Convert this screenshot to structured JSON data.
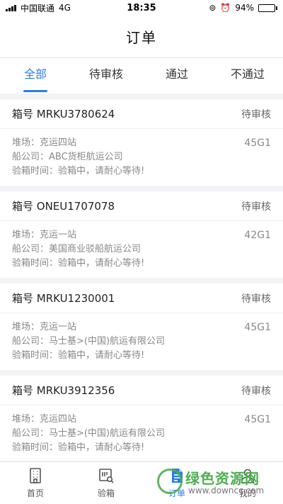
{
  "status_bar": {
    "carrier": "中国联通",
    "network": "4G",
    "time": "18:35",
    "battery": "94%",
    "battery_level": 0.94
  },
  "header": {
    "title": "订单"
  },
  "tabs": [
    {
      "label": "全部",
      "active": true
    },
    {
      "label": "待审核",
      "active": false
    },
    {
      "label": "通过",
      "active": false
    },
    {
      "label": "不通过",
      "active": false
    }
  ],
  "orders": [
    {
      "box_no": "箱号 MRKU3780624",
      "status": "待审核",
      "yard": "堆场：克运四站",
      "company": "船公司：ABC货柜航运公司",
      "inspection": "验箱时间：验箱中，请耐心等待!",
      "size": "45G1"
    },
    {
      "box_no": "箱号 ONEU1707078",
      "status": "待审核",
      "yard": "堆场：克运一站",
      "company": "船公司：美国商业驳船航运公司",
      "inspection": "验箱时间：验箱中，请耐心等待!",
      "size": "42G1"
    },
    {
      "box_no": "箱号 MRKU1230001",
      "status": "待审核",
      "yard": "堆场：克运一站",
      "company": "船公司：马士基>(中国)航运有限公司",
      "inspection": "验箱时间：验箱中，请耐心等待!",
      "size": "45G1"
    },
    {
      "box_no": "箱号 MRKU3912356",
      "status": "待审核",
      "yard": "堆场：克运四站",
      "company": "船公司：马士基>(中国)航运有限公司",
      "inspection": "验箱时间：验箱中，请耐心等待!",
      "size": "45G1"
    }
  ],
  "tabbar": [
    {
      "label": "首页",
      "icon": "building-icon",
      "active": false
    },
    {
      "label": "验箱",
      "icon": "inspect-icon",
      "active": false
    },
    {
      "label": "订单",
      "icon": "document-icon",
      "active": true
    },
    {
      "label": "我的",
      "icon": "user-icon",
      "active": false
    }
  ],
  "watermark": {
    "text": "绿色资源网",
    "url": "www.downcc.com"
  },
  "colors": {
    "accent": "#2b7de9",
    "watermark": "#4caf50"
  }
}
